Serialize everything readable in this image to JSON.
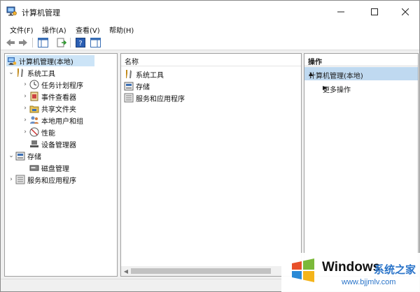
{
  "window": {
    "title": "计算机管理"
  },
  "menu": [
    "文件(F)",
    "操作(A)",
    "查看(V)",
    "帮助(H)"
  ],
  "toolbar": {
    "icons": [
      "back-arrow-icon",
      "forward-arrow-icon",
      "console-tree-icon",
      "export-list-icon",
      "help-icon",
      "action-pane-icon"
    ]
  },
  "tree": {
    "root": "计算机管理(本地)",
    "system_tools": "系统工具",
    "task_scheduler": "任务计划程序",
    "event_viewer": "事件查看器",
    "shared_folders": "共享文件夹",
    "local_users": "本地用户和组",
    "performance": "性能",
    "device_manager": "设备管理器",
    "storage": "存储",
    "disk_management": "磁盘管理",
    "services_apps": "服务和应用程序"
  },
  "list": {
    "column_name": "名称",
    "items": [
      "系统工具",
      "存储",
      "服务和应用程序"
    ]
  },
  "actions": {
    "title": "操作",
    "section": "计算机管理(本地)",
    "more": "更多操作"
  },
  "watermark": {
    "brand": "Windows",
    "brand_cn": "系统之家",
    "url": "www.bjjmlv.com"
  },
  "colors": {
    "selection": "#cce4f7",
    "action_section": "#bfd9f0",
    "watermark_blue": "#2a74c9"
  }
}
